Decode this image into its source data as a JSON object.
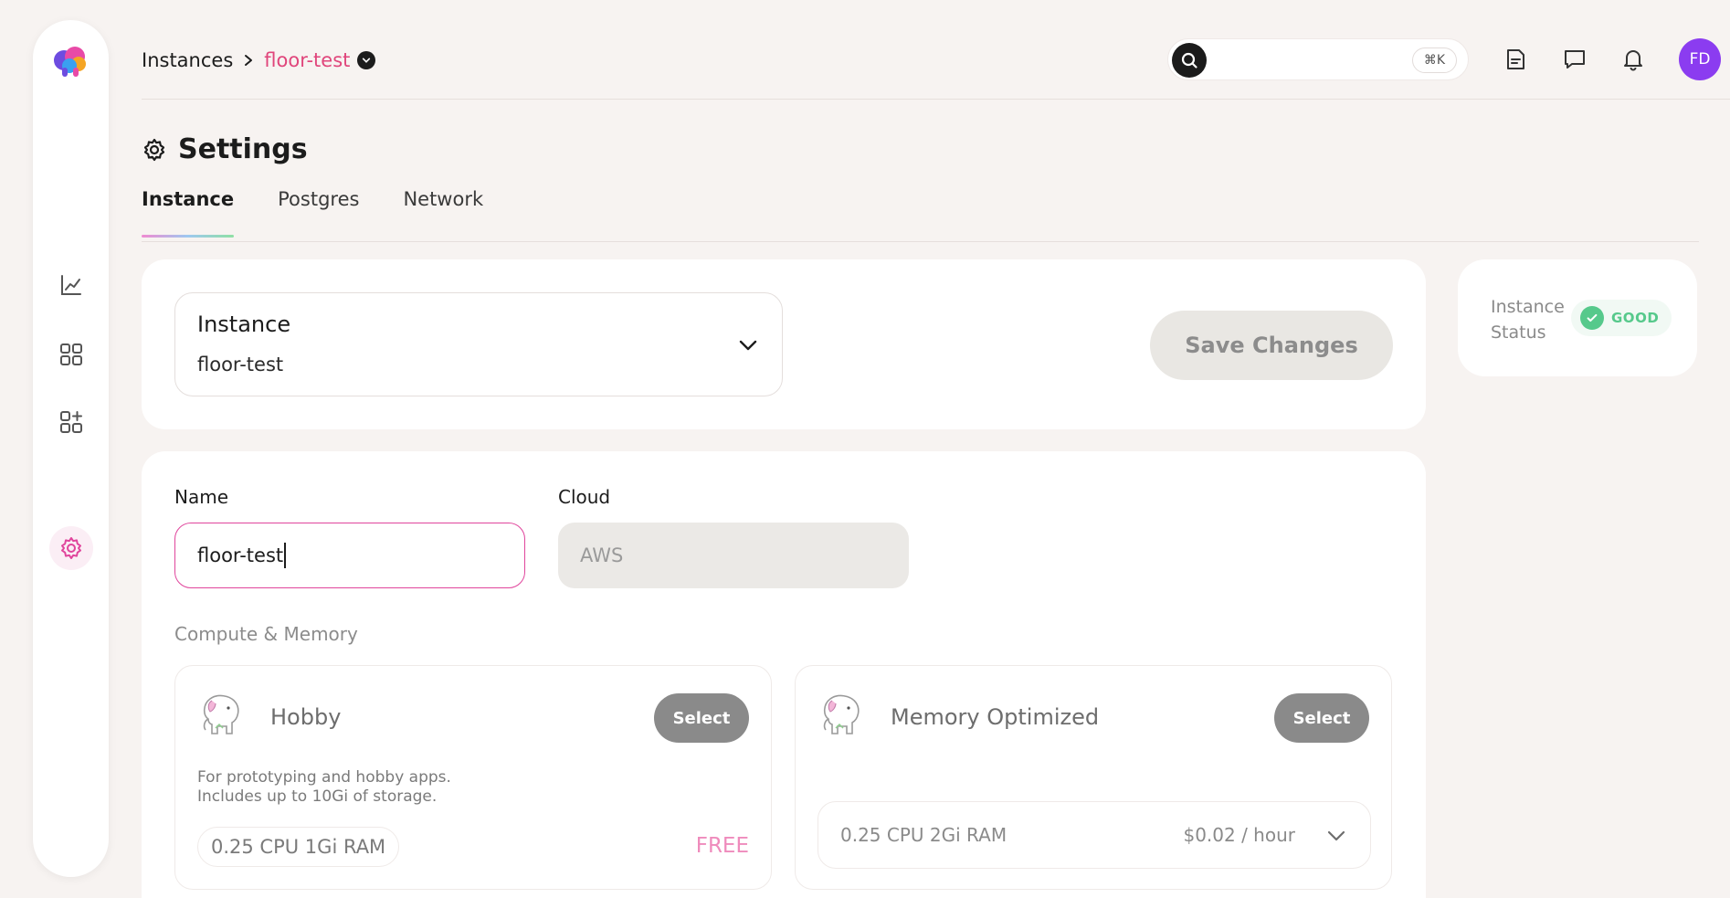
{
  "breadcrumb": {
    "root": "Instances",
    "current": "floor-test"
  },
  "search": {
    "placeholder": "",
    "shortcut": "⌘K"
  },
  "user": {
    "initials": "FD"
  },
  "page": {
    "title": "Settings"
  },
  "tabs": [
    {
      "label": "Instance",
      "active": true
    },
    {
      "label": "Postgres",
      "active": false
    },
    {
      "label": "Network",
      "active": false
    }
  ],
  "instance_select": {
    "label": "Instance",
    "value": "floor-test"
  },
  "save_button": {
    "label": "Save Changes"
  },
  "status": {
    "label": "Instance Status",
    "badge": "GOOD"
  },
  "form": {
    "name_label": "Name",
    "name_value": "floor-test",
    "cloud_label": "Cloud",
    "cloud_value": "AWS"
  },
  "compute": {
    "section_label": "Compute & Memory",
    "plans": [
      {
        "name": "Hobby",
        "select_label": "Select",
        "description_line1": "For prototyping and hobby apps.",
        "description_line2": "Includes up to 10Gi of storage.",
        "spec": "0.25 CPU 1Gi RAM",
        "price": "FREE"
      },
      {
        "name": "Memory Optimized",
        "select_label": "Select",
        "spec": "0.25 CPU 2Gi RAM",
        "price": "$0.02 / hour"
      }
    ]
  },
  "colors": {
    "accent_pink": "#e0457b",
    "status_good": "#56c98b",
    "avatar": "#8b3cf0",
    "background": "#f7f3f1"
  },
  "icons": {
    "rail": [
      "chart-icon",
      "grid-icon",
      "grid-plus-icon",
      "settings-icon"
    ],
    "topbar": [
      "notes-icon",
      "chat-icon",
      "bell-icon"
    ]
  }
}
